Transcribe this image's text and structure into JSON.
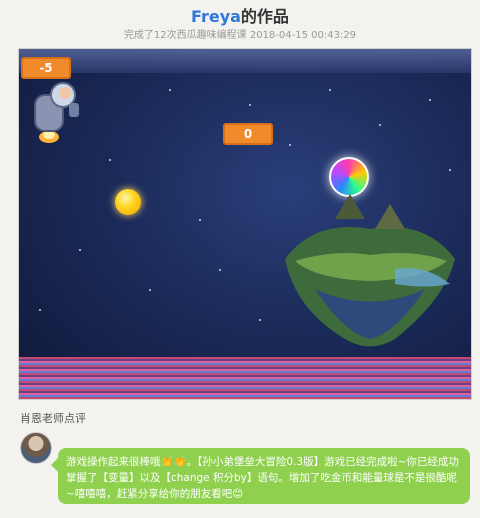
{
  "header": {
    "title_name": "Freya",
    "title_suffix": "的作品",
    "subtitle": "完成了12次西瓜趣味编程课 2018-04-15 00:43:29"
  },
  "stage": {
    "monitor_left": "-5",
    "monitor_center": "0"
  },
  "comments": {
    "section_label": "肖恩老师点评",
    "text": "游戏操作起来很棒哦👏👏。【孙小弟堡垒大冒险0.3版】游戏已经完成啦~你已经成功掌握了【变量】以及【change 积分by】语句。增加了吃金币和能量球是不是很酷呢~嘻嘻嘻，赶紧分享给你的朋友看吧😊"
  },
  "colors": {
    "accent": "#2f77d8",
    "bubble": "#8fd14f",
    "monitor": "#f08a2a"
  }
}
